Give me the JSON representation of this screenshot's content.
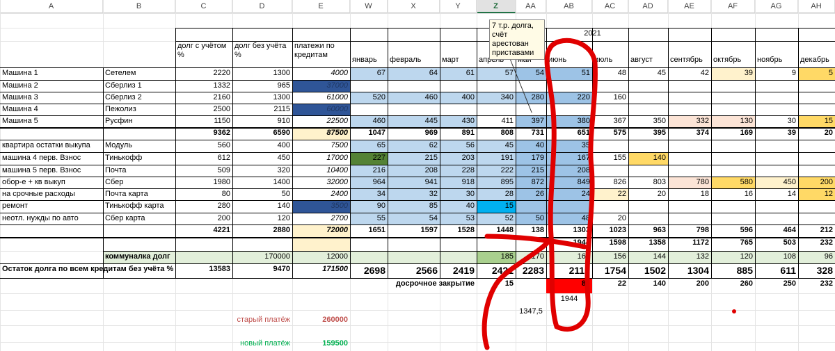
{
  "columns": [
    "A",
    "B",
    "C",
    "D",
    "E",
    "W",
    "X",
    "Y",
    "Z",
    "AA",
    "AB",
    "AC",
    "AD",
    "AE",
    "AF",
    "AG",
    "AH"
  ],
  "selected_column": "Z",
  "year": "2021",
  "headers": {
    "C": "долг с учётом %",
    "D": "долг без учёта %",
    "E": "платежи по кредитам"
  },
  "months": [
    "январь",
    "февраль",
    "март",
    "апрель",
    "май",
    "июнь",
    "июль",
    "август",
    "сентябрь",
    "октябрь",
    "ноябрь",
    "декабрь"
  ],
  "rows": [
    {
      "a": "Машина 1",
      "b": "Сетелем",
      "c": "2220",
      "d": "1300",
      "e": "4000",
      "m": [
        "67",
        "64",
        "61",
        "57",
        "54",
        "51",
        "48",
        "45",
        "42",
        "39",
        "9",
        "5"
      ]
    },
    {
      "a": "Машина 2",
      "b": "Сберлиз 1",
      "c": "1332",
      "d": "965",
      "e": "37000",
      "m": [
        "",
        "",
        "",
        "",
        "",
        "",
        "",
        "",
        "",
        "",
        "",
        ""
      ]
    },
    {
      "a": "Машина 3",
      "b": "Сберлиз 2",
      "c": "2160",
      "d": "1300",
      "e": "61000",
      "m": [
        "520",
        "460",
        "400",
        "340",
        "280",
        "220",
        "160",
        "",
        "",
        "",
        "",
        ""
      ]
    },
    {
      "a": "Машина 4",
      "b": "Пежолиз",
      "c": "2500",
      "d": "2115",
      "e": "60000",
      "m": [
        "",
        "",
        "",
        "",
        "",
        "",
        "",
        "",
        "",
        "",
        "",
        ""
      ]
    },
    {
      "a": "Машина 5",
      "b": "Русфин",
      "c": "1150",
      "d": "910",
      "e": "22500",
      "m": [
        "460",
        "445",
        "430",
        "411",
        "397",
        "380",
        "367",
        "350",
        "332",
        "130",
        "30",
        "15"
      ]
    },
    {
      "a": "",
      "b": "",
      "c": "9362",
      "d": "6590",
      "e": "87500",
      "m": [
        "1047",
        "969",
        "891",
        "808",
        "731",
        "651",
        "575",
        "395",
        "374",
        "169",
        "39",
        "20"
      ]
    },
    {
      "a": "квартира остатки выкупа",
      "b": "Модуль",
      "c": "560",
      "d": "400",
      "e": "7500",
      "m": [
        "65",
        "62",
        "56",
        "45",
        "40",
        "35",
        "",
        "",
        "",
        "",
        "",
        ""
      ]
    },
    {
      "a": "машина 4 перв. Взнос",
      "b": "Тинькофф",
      "c": "612",
      "d": "450",
      "e": "17000",
      "m": [
        "227",
        "215",
        "203",
        "191",
        "179",
        "167",
        "155",
        "140",
        "",
        "",
        "",
        ""
      ]
    },
    {
      "a": "машина 5 перв. Взнос",
      "b": "Почта",
      "c": "509",
      "d": "320",
      "e": "10400",
      "m": [
        "216",
        "208",
        "228",
        "222",
        "215",
        "208",
        "",
        "",
        "",
        "",
        "",
        ""
      ]
    },
    {
      "a": "обор-е + кв выкуп",
      "b": "Сбер",
      "c": "1980",
      "d": "1400",
      "e": "32000",
      "m": [
        "964",
        "941",
        "918",
        "895",
        "872",
        "849",
        "826",
        "803",
        "780",
        "580",
        "450",
        "200"
      ]
    },
    {
      "a": "на срочные расходы",
      "b": "Почта карта",
      "c": "80",
      "d": "50",
      "e": "2400",
      "m": [
        "34",
        "32",
        "30",
        "28",
        "26",
        "24",
        "22",
        "20",
        "18",
        "16",
        "14",
        "12"
      ]
    },
    {
      "a": "ремонт",
      "b": "Тинькофф карта",
      "c": "280",
      "d": "140",
      "e": "3500",
      "m": [
        "90",
        "85",
        "40",
        "15",
        "",
        "",
        "",
        "",
        "",
        "",
        "",
        ""
      ]
    },
    {
      "a": "неотл. нужды по авто",
      "b": "Сбер карта",
      "c": "200",
      "d": "120",
      "e": "2700",
      "m": [
        "55",
        "54",
        "53",
        "52",
        "50",
        "48",
        "20",
        "",
        "",
        "",
        "",
        ""
      ]
    },
    {
      "a": "",
      "b": "",
      "c": "4221",
      "d": "2880",
      "e": "72000",
      "m": [
        "1651",
        "1597",
        "1528",
        "1448",
        "138",
        "1303",
        "1023",
        "963",
        "798",
        "596",
        "464",
        "212"
      ]
    }
  ],
  "row_1944": {
    "ab": "1944",
    "ac": "1598",
    "ad": "1358",
    "ae": "1172",
    "af": "765",
    "ag": "503",
    "ah": "232"
  },
  "kommunalka": {
    "label": "коммуналка долг",
    "d": "170000",
    "e": "12000",
    "m": [
      "",
      "",
      "",
      "185",
      "170",
      "168",
      "156",
      "144",
      "132",
      "120",
      "108",
      "96"
    ]
  },
  "ostatok": {
    "label": "Остаток долга по всем кредитам без учёта %",
    "c": "13583",
    "d": "9470",
    "e": "171500",
    "m": [
      "2698",
      "2566",
      "2419",
      "2421",
      "2283",
      "2112",
      "1754",
      "1502",
      "1304",
      "885",
      "611",
      "328"
    ]
  },
  "dosrochnoe": {
    "label": "досрочное закрытие",
    "m": [
      "",
      "",
      "",
      "15",
      "",
      "83",
      "22",
      "140",
      "200",
      "260",
      "250",
      "232"
    ]
  },
  "extra": {
    "ab_1944": "1944",
    "aa_1347": "1347,5"
  },
  "old_payment": {
    "label": "старый платёж",
    "value": "260000"
  },
  "new_payment": {
    "label": "новый платёж",
    "value": "159500"
  },
  "comment": "7 т.р. долга, счёт арестован приставами",
  "colors": {
    "light_blue": "#bdd7ee",
    "mid_blue": "#9dc3e6",
    "dark_blue": "#2f5597",
    "green": "#548235",
    "cyan": "#00b0f0",
    "peach": "#fce4d6",
    "yellow": "#ffd966",
    "light_yellow": "#fff2cc",
    "light_green": "#e2efda",
    "red": "#ff0000",
    "ink": "#e00000"
  }
}
